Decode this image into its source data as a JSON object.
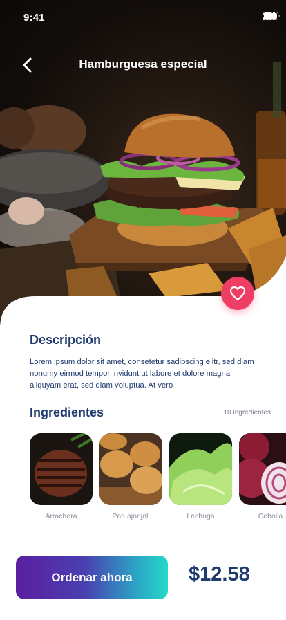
{
  "status_bar": {
    "time": "9:41"
  },
  "header": {
    "title": "Hamburguesa especial"
  },
  "description": {
    "heading": "Descripción",
    "text": "Lorem ipsum dolor sit amet, consetetur sadipscing elitr, sed diam nonumy eirmod tempor invidunt ut labore et dolore magna aliquyam erat, sed diam voluptua. At vero"
  },
  "ingredients": {
    "heading": "Ingredientes",
    "count": "10 ingredientes",
    "items": [
      {
        "label": "Arrachera"
      },
      {
        "label": "Pan ajonjoli"
      },
      {
        "label": "Lechuga"
      },
      {
        "label": "Cebolla"
      }
    ]
  },
  "footer": {
    "order_label": "Ordenar ahora",
    "price": "$12.58"
  },
  "colors": {
    "accent": "#ef3e63",
    "primary_text": "#1f3b6e",
    "gradient_start": "#5b1fa0",
    "gradient_end": "#26d8c6"
  }
}
